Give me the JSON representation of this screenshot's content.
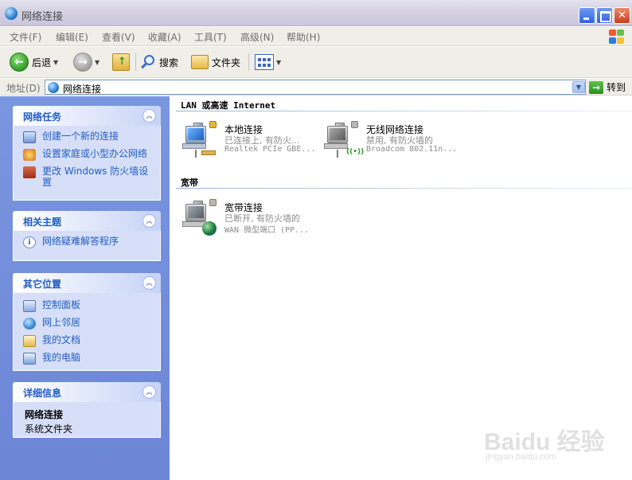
{
  "window": {
    "title": "网络连接"
  },
  "menu": [
    "文件(F)",
    "编辑(E)",
    "查看(V)",
    "收藏(A)",
    "工具(T)",
    "高级(N)",
    "帮助(H)"
  ],
  "toolbar": {
    "back": "后退",
    "search": "搜索",
    "folders": "文件夹"
  },
  "address": {
    "label": "地址(D)",
    "value": "网络连接",
    "go": "转到"
  },
  "left": {
    "tasks": {
      "title": "网络任务",
      "items": [
        "创建一个新的连接",
        "设置家庭或小型办公网络",
        "更改 Windows 防火墙设置"
      ]
    },
    "related": {
      "title": "相关主题",
      "items": [
        "网络疑难解答程序"
      ]
    },
    "places": {
      "title": "其它位置",
      "items": [
        "控制面板",
        "网上邻居",
        "我的文档",
        "我的电脑"
      ]
    },
    "details": {
      "title": "详细信息",
      "name": "网络连接",
      "type": "系统文件夹"
    }
  },
  "content": {
    "groups": [
      {
        "title": "LAN 或高速 Internet",
        "items": [
          {
            "name": "本地连接",
            "status": "已连接上, 有防火...",
            "device": "Realtek PCIe GBE..."
          },
          {
            "name": "无线网络连接",
            "status": "禁用, 有防火墙的",
            "device": "Broadcom 802.11n..."
          }
        ]
      },
      {
        "title": "宽带",
        "items": [
          {
            "name": "宽带连接",
            "status": "已断开, 有防火墙的",
            "device": "WAN 微型端口 (PP..."
          }
        ]
      }
    ]
  },
  "watermark": {
    "brand": "Bai",
    "brand2": "du 经验",
    "url": "jingyan.baidu.com"
  }
}
